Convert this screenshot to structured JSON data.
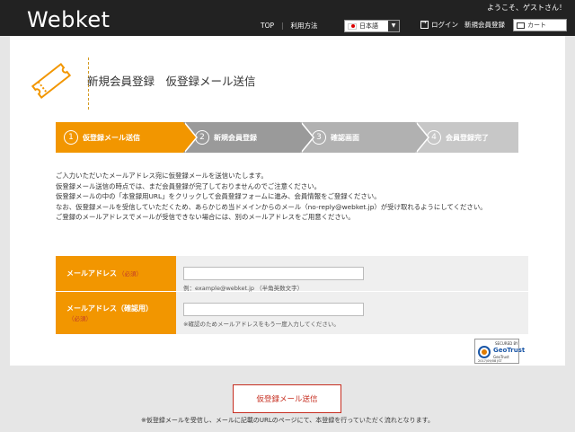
{
  "header": {
    "logo": "Webket",
    "welcome": "ようこそ、ゲストさん！",
    "nav": {
      "top": "TOP",
      "guide": "利用方法"
    },
    "language": "日本語",
    "login": "ログイン",
    "register": "新規会員登録",
    "cart": "カート"
  },
  "page": {
    "title": "新規会員登録　仮登録メール送信"
  },
  "steps": [
    {
      "num": "1",
      "label": "仮登録メール送信",
      "active": true
    },
    {
      "num": "2",
      "label": "新規会員登録"
    },
    {
      "num": "3",
      "label": "確認画面"
    },
    {
      "num": "4",
      "label": "会員登録完了"
    }
  ],
  "intro": [
    "ご入力いただいたメールアドレス宛に仮登録メールを送信いたします。",
    "仮登録メール送信の時点では、まだ会員登録が完了しておりませんのでご注意ください。",
    "仮登録メールの中の「本登録用URL」をクリックして会員登録フォームに進み、会員情報をご登録ください。",
    "なお、仮登録メールを受信していただくため、あらかじめ当ドメインからのメール（no-reply@webket.jp）が受け取れるようにしてください。",
    "ご登録のメールアドレスでメールが受信できない場合には、別のメールアドレスをご用意ください。"
  ],
  "form": {
    "email_label": "メールアドレス",
    "email_required": "（必須）",
    "email_value": "",
    "email_hint": "例：example@webket.jp （半角英数文字）",
    "confirm_label": "メールアドレス（確認用）",
    "confirm_required": "（必須）",
    "confirm_value": "",
    "confirm_hint": "※確認のためメールアドレスをもう一度入力してください。"
  },
  "seal": {
    "secured_by": "SECURED BY",
    "brand": "GeoTrust",
    "sub": "GeoTrust",
    "date": "2017/09/08 JST"
  },
  "actions": {
    "submit": "仮登録メール送信",
    "note": "※仮登録メールを受信し、メールに記載のURLのページにて、本登録を行っていただく流れとなります。"
  },
  "colors": {
    "accent": "#f29600",
    "header": "#222222",
    "submit_border": "#c62d1f"
  }
}
